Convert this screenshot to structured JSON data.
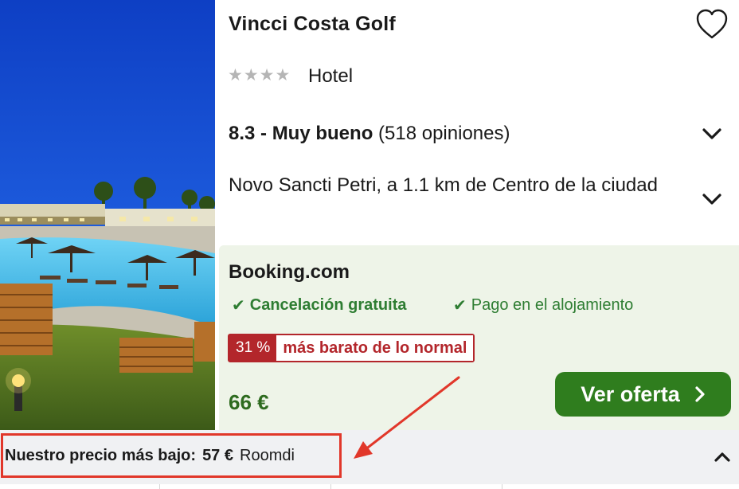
{
  "hotel": {
    "name": "Vincci Costa Golf",
    "stars": 4,
    "type": "Hotel",
    "rating_score": "8.3 - Muy bueno",
    "rating_reviews": "(518 opiniones)",
    "location": "Novo Sancti Petri, a 1.1 km de Centro de la ciudad"
  },
  "offer": {
    "provider": "Booking.com",
    "perk_1": "Cancelación gratuita",
    "perk_2": "Pago en el alojamiento",
    "discount_pct": "31 %",
    "discount_text": "más barato de lo normal",
    "price": "66 €",
    "cta_label": "Ver oferta"
  },
  "lowest": {
    "label": "Nuestro precio más bajo:",
    "price": "57 €",
    "source": "Roomdi"
  },
  "icons": {
    "favorite": "heart-icon",
    "expand": "chevron-down-icon",
    "collapse": "chevron-up-icon",
    "check": "check-icon",
    "cta_arrow": "chevron-right-icon"
  },
  "colors": {
    "offer_bg": "#eef4e8",
    "cta_green": "#2f7d1e",
    "price_green": "#2e6b1f",
    "deal_red": "#b3262b",
    "highlight_red": "#e1372a"
  }
}
